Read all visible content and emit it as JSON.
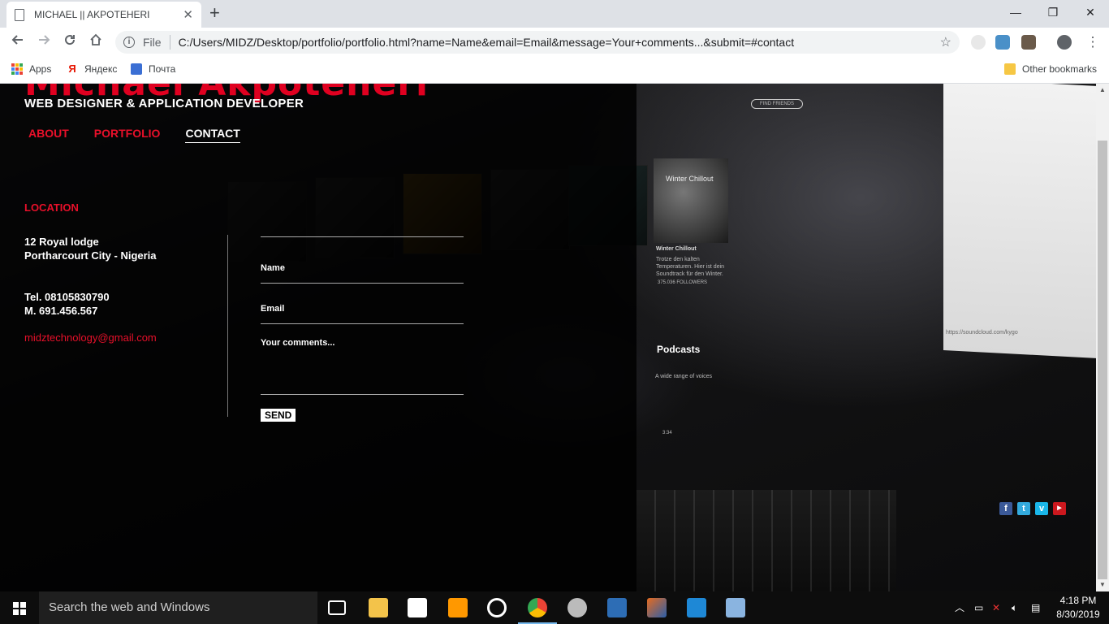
{
  "browser": {
    "tab_title": "MICHAEL || AKPOTEHERI",
    "tab_close": "✕",
    "new_tab": "+",
    "file_label": "File",
    "url": "C:/Users/MIDZ/Desktop/portfolio/portfolio.html?name=Name&email=Email&message=Your+comments...&submit=#contact",
    "window_controls": {
      "minimize": "—",
      "maximize": "❐",
      "close": "✕"
    },
    "bookmarks": [
      {
        "label": "Apps",
        "icon": "apps-grid-icon"
      },
      {
        "label": "Яндекс",
        "icon": "yandex-icon"
      },
      {
        "label": "Почта",
        "icon": "mail-icon"
      }
    ],
    "other_bookmarks": "Other bookmarks"
  },
  "site": {
    "name": "Michael Akpoteheri",
    "subtitle": "WEB DESIGNER & APPLICATION DEVELOPER",
    "nav": [
      "ABOUT",
      "PORTFOLIO",
      "CONTACT"
    ],
    "active_nav": "CONTACT",
    "accent": "#e8102a"
  },
  "contact": {
    "location_heading": "LOCATION",
    "address_line1": "12 Royal lodge",
    "address_line2": "Portharcourt City - Nigeria",
    "tel": "Tel. 08105830790",
    "mobile": "M. 691.456.567",
    "email": "midztechnology@gmail.com"
  },
  "form": {
    "name_label": "Name",
    "email_label": "Email",
    "comments_label": "Your comments...",
    "send_label": "SEND"
  },
  "background": {
    "find_friends": "FIND FRIENDS",
    "winter_chillout": "Winter Chillout",
    "winter_desc": "Trotze den kalten Temperaturen. Hier ist dein Soundtrack für den Winter.",
    "followers": "375.036 FOLLOWERS",
    "podcasts": "Podcasts",
    "podcasts_desc": "A wide range of voices",
    "duration": "3:34",
    "monitor_url": "https://soundcloud.com/kygo"
  },
  "social": [
    "facebook-icon",
    "twitter-icon",
    "vimeo-icon",
    "youtube-icon"
  ],
  "taskbar": {
    "search_placeholder": "Search the web and Windows",
    "time": "4:18 PM",
    "date": "8/30/2019"
  }
}
